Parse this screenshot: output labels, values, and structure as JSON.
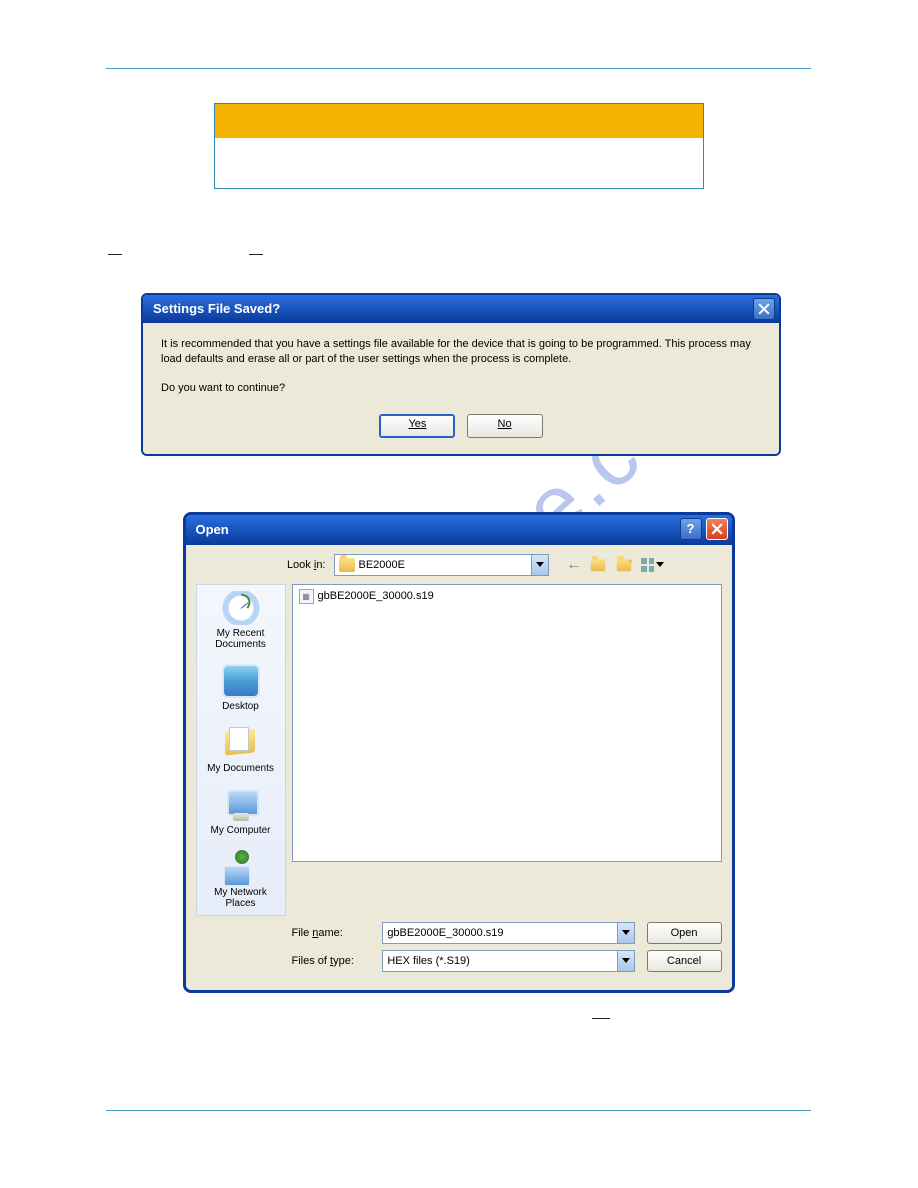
{
  "watermark": "manualshive.com",
  "dialog1": {
    "title": "Settings File Saved?",
    "line1": "It is recommended that you have a settings file available for the device that is going to be programmed.  This process may load defaults and erase all or part of the user settings when the process is complete.",
    "line2": "Do you want to continue?",
    "yes": "Yes",
    "no": "No"
  },
  "dialog2": {
    "title": "Open",
    "lookin_label": "Look in:",
    "lookin_value": "BE2000E",
    "help": "?",
    "file_item": "gbBE2000E_30000.s19",
    "places": {
      "recent": "My Recent Documents",
      "desktop": "Desktop",
      "mydocs": "My Documents",
      "mycomputer": "My Computer",
      "mynetwork": "My Network Places"
    },
    "filename_label_pre": "File ",
    "filename_label_u": "n",
    "filename_label_post": "ame:",
    "filename_value": "gbBE2000E_30000.s19",
    "filetype_label_pre": "Files of ",
    "filetype_label_u": "t",
    "filetype_label_post": "ype:",
    "filetype_value": "HEX files (*.S19)",
    "open_u": "O",
    "open_post": "pen",
    "cancel": "Cancel"
  }
}
